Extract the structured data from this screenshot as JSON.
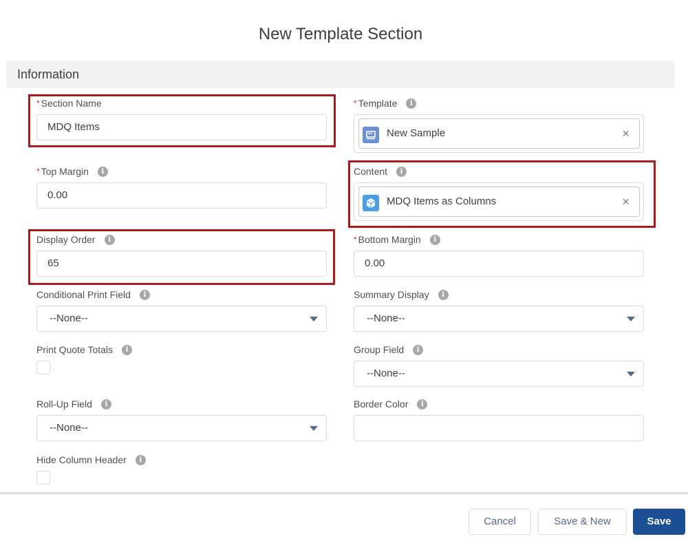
{
  "modal": {
    "title": "New Template Section",
    "section_header": "Information"
  },
  "fields": {
    "section_name": {
      "label": "Section Name",
      "required": "*",
      "value": "MDQ Items"
    },
    "template": {
      "label": "Template",
      "required": "*",
      "value": "New Sample",
      "icon": "template-icon",
      "clear": "×"
    },
    "top_margin": {
      "label": "Top Margin",
      "required": "*",
      "value": "0.00"
    },
    "content": {
      "label": "Content",
      "value": "MDQ Items as Columns",
      "icon": "content-cube-icon",
      "clear": "×"
    },
    "display_order": {
      "label": "Display Order",
      "value": "65"
    },
    "bottom_margin": {
      "label": "Bottom Margin",
      "required": "*",
      "value": "0.00"
    },
    "conditional_print_field": {
      "label": "Conditional Print Field",
      "value": "--None--"
    },
    "summary_display": {
      "label": "Summary Display",
      "value": "--None--"
    },
    "print_quote_totals": {
      "label": "Print Quote Totals",
      "checked": false
    },
    "group_field": {
      "label": "Group Field",
      "value": "--None--"
    },
    "roll_up_field": {
      "label": "Roll-Up Field",
      "value": "--None--"
    },
    "border_color": {
      "label": "Border Color",
      "value": ""
    },
    "hide_column_header": {
      "label": "Hide Column Header",
      "checked": false
    }
  },
  "info_glyph": "i",
  "buttons": {
    "cancel": "Cancel",
    "save_new": "Save & New",
    "save": "Save"
  },
  "colors": {
    "highlight": "#a61b1b",
    "primary_button": "#1b4e93",
    "required": "#c23934"
  }
}
